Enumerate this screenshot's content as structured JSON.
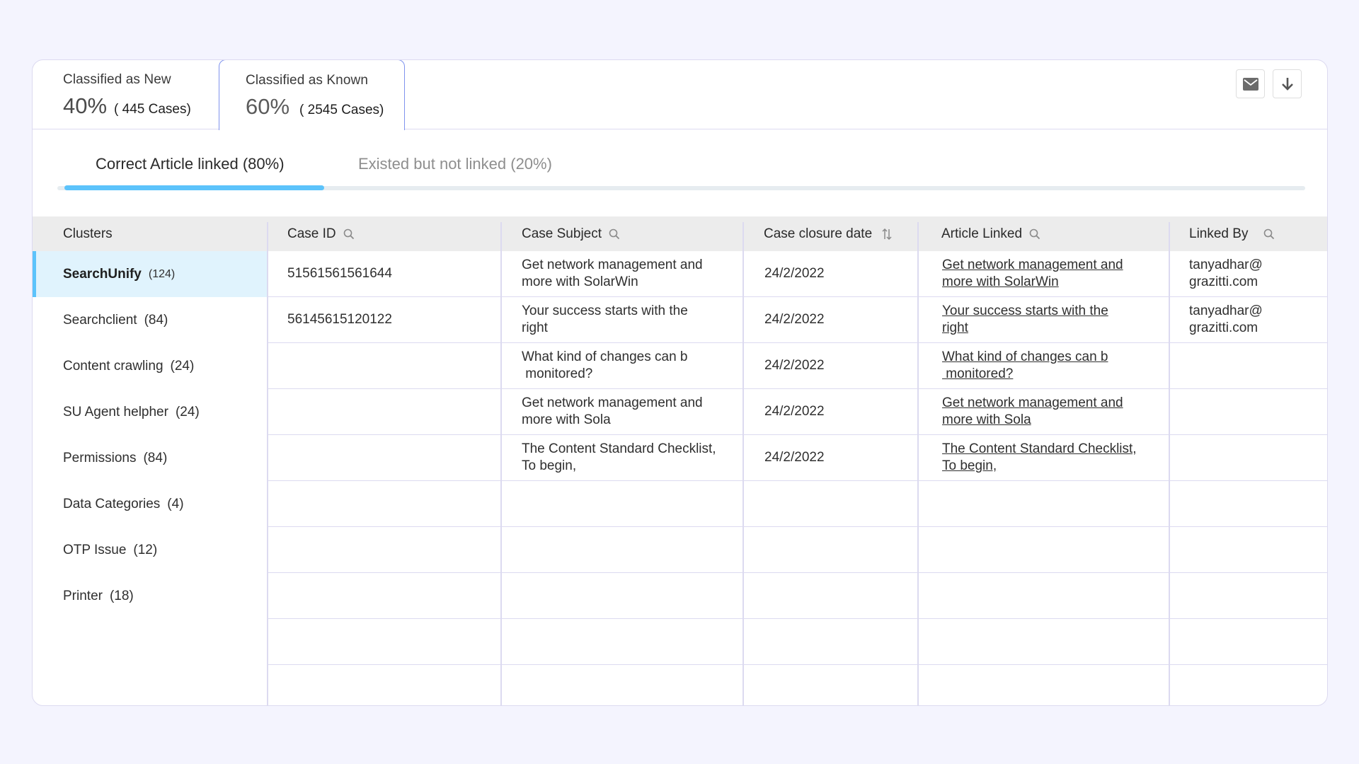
{
  "summary_tabs": [
    {
      "title": "Classified as New",
      "percent": "40%",
      "cases": "( 445 Cases)",
      "active": false
    },
    {
      "title": "Classified as Known",
      "percent": "60%",
      "cases": "( 2545 Cases)",
      "active": true
    }
  ],
  "toolbar": {
    "mail_icon": "mail-icon",
    "download_icon": "download-icon"
  },
  "sub_tabs": [
    {
      "label": "Correct Article linked (80%)",
      "active": true
    },
    {
      "label": "Existed but not linked (20%)",
      "active": false
    }
  ],
  "sub_tab_progress": 0.26,
  "colors": {
    "accent": "#5cc3fb",
    "active_tab_border": "#7f93ee",
    "highlight_row": "#e0f3fd",
    "header_bg": "#ececec",
    "page_bg": "#f4f4fe"
  },
  "table": {
    "columns": [
      {
        "label": "Clusters",
        "icon": null
      },
      {
        "label": "Case ID",
        "icon": "search-icon"
      },
      {
        "label": "Case Subject",
        "icon": "search-icon"
      },
      {
        "label": "Case closure date",
        "icon": "sort-icon"
      },
      {
        "label": "Article Linked",
        "icon": "search-icon"
      },
      {
        "label": "Linked By",
        "icon": "search-icon"
      }
    ],
    "clusters": [
      {
        "name": "SearchUnify",
        "count": "(124)",
        "active": true
      },
      {
        "name": "Searchclient",
        "count": "(84)",
        "active": false
      },
      {
        "name": "Content crawling",
        "count": "(24)",
        "active": false
      },
      {
        "name": "SU Agent helpher",
        "count": "(24)",
        "active": false
      },
      {
        "name": "Permissions",
        "count": "(84)",
        "active": false
      },
      {
        "name": "Data Categories",
        "count": "(4)",
        "active": false
      },
      {
        "name": "OTP Issue",
        "count": "(12)",
        "active": false
      },
      {
        "name": "Printer",
        "count": "(18)",
        "active": false
      }
    ],
    "rows": [
      {
        "case_id": "51561561561644",
        "subject": [
          "Get network management and",
          "more with SolarWin"
        ],
        "date": "24/2/2022",
        "article": [
          "Get network management and",
          "more with SolarWin"
        ],
        "linked_by": [
          "tanyadhar@",
          "grazitti.com"
        ]
      },
      {
        "case_id": "56145615120122",
        "subject": [
          "Your success starts with the",
          "right"
        ],
        "date": "24/2/2022",
        "article": [
          "Your success starts with the",
          "right"
        ],
        "linked_by": [
          "tanyadhar@",
          "grazitti.com"
        ]
      },
      {
        "case_id": "",
        "subject": [
          "What kind of changes can b",
          " monitored?"
        ],
        "date": "24/2/2022",
        "article": [
          "What kind of changes can b",
          " monitored?"
        ],
        "linked_by": [
          "",
          ""
        ]
      },
      {
        "case_id": "",
        "subject": [
          "Get network management and",
          "more with Sola"
        ],
        "date": "24/2/2022",
        "article": [
          "Get network management and",
          "more with Sola"
        ],
        "linked_by": [
          "",
          ""
        ]
      },
      {
        "case_id": "",
        "subject": [
          "The Content Standard Checklist,",
          "To begin,"
        ],
        "date": "24/2/2022",
        "article": [
          "The Content Standard Checklist,",
          "To begin,"
        ],
        "linked_by": [
          "",
          ""
        ]
      },
      {
        "case_id": "",
        "subject": [
          "",
          ""
        ],
        "date": "",
        "article": [
          "",
          ""
        ],
        "linked_by": [
          "",
          ""
        ]
      },
      {
        "case_id": "",
        "subject": [
          "",
          ""
        ],
        "date": "",
        "article": [
          "",
          ""
        ],
        "linked_by": [
          "",
          ""
        ]
      },
      {
        "case_id": "",
        "subject": [
          "",
          ""
        ],
        "date": "",
        "article": [
          "",
          ""
        ],
        "linked_by": [
          "",
          ""
        ]
      },
      {
        "case_id": "",
        "subject": [
          "",
          ""
        ],
        "date": "",
        "article": [
          "",
          ""
        ],
        "linked_by": [
          "",
          ""
        ]
      },
      {
        "case_id": "",
        "subject": [
          "",
          ""
        ],
        "date": "",
        "article": [
          "",
          ""
        ],
        "linked_by": [
          "",
          ""
        ]
      }
    ]
  }
}
